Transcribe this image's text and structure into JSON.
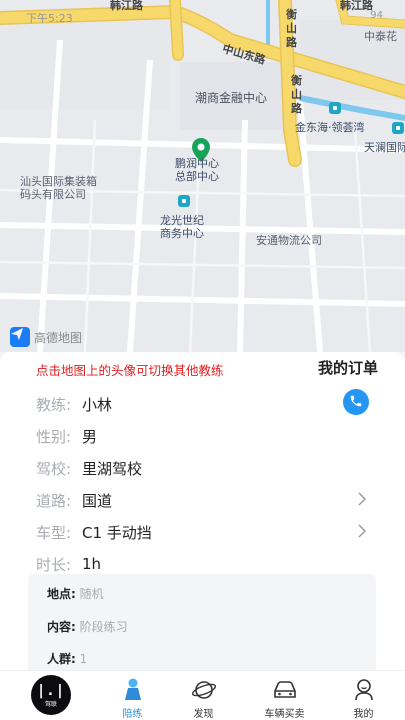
{
  "status": {
    "time": "下午5:23",
    "right": "94"
  },
  "map": {
    "roads": {
      "hanjiang_left": "韩江路",
      "hanjiang_right": "韩江路",
      "zhongshan_east": "中山东路",
      "hengshan_top": "衡山路",
      "hengshan_mid": "衡山路"
    },
    "labels": {
      "chaoshang": "潮商金融中心",
      "zhongtai": "中泰花",
      "gold_east": "金东海·领荟湾",
      "tianlan": "天澜国际",
      "shantou_container": "汕头国际集装箱\n码头有限公司",
      "longguang": "龙光世纪\n商务中心",
      "hq": "总部中心",
      "hq_top": "鹏润中心",
      "antong": "安通物流公司"
    },
    "gaode_text": "高德地图"
  },
  "panel": {
    "tip": "点击地图上的头像可切换其他教练",
    "my_order": "我的订单",
    "rows": [
      {
        "label": "教练:",
        "value": "小林"
      },
      {
        "label": "性别:",
        "value": "男"
      },
      {
        "label": "驾校:",
        "value": "里湖驾校"
      },
      {
        "label": "道路:",
        "value": "国道"
      },
      {
        "label": "车型:",
        "value": "C1 手动挡"
      },
      {
        "label": "时长:",
        "value": "1h"
      }
    ],
    "card": [
      {
        "k": "地点:",
        "v": "随机"
      },
      {
        "k": "内容:",
        "v": "阶段练习"
      },
      {
        "k": "人群:",
        "v": "1"
      }
    ]
  },
  "tabbar": {
    "logo_sub": "驾联",
    "tabs": [
      {
        "label": "陪练",
        "icon": "trainer-icon"
      },
      {
        "label": "发现",
        "icon": "planet-icon"
      },
      {
        "label": "车辆买卖",
        "icon": "car-icon"
      },
      {
        "label": "我的",
        "icon": "profile-icon"
      }
    ]
  },
  "colors": {
    "accent": "#2596f3",
    "tip_red": "#e02020",
    "active_tab": "#2f8bd8",
    "road_yellow": "#f7d86a"
  }
}
